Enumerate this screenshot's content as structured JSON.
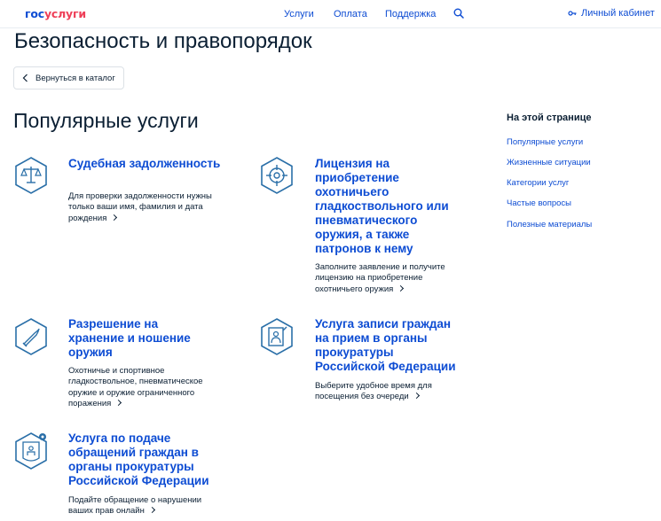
{
  "header": {
    "logo_part1": "гос",
    "logo_part2": "услуги",
    "nav": [
      "Услуги",
      "Оплата",
      "Поддержка"
    ],
    "cabinet_label": "Личный кабинет"
  },
  "page": {
    "title": "Безопасность и правопорядок",
    "back_label": "Вернуться в каталог",
    "section_title": "Популярные услуги"
  },
  "services": [
    {
      "title": "Судебная задолженность",
      "desc": "Для проверки задолженности нужны только ваши имя, фамилия и дата рождения",
      "icon": "scales-icon"
    },
    {
      "title": "Лицензия на приобретение охотничьего гладкоствольного или пневматического оружия, а также патронов к нему",
      "desc": "Заполните заявление и получите лицензию на приобретение охотничьего оружия",
      "icon": "target-icon"
    },
    {
      "title": "Разрешение на хранение и ношение оружия",
      "desc": "Охотничье и спортивное гладкоствольное, пневматическое оружие и оружие ограниченного поражения",
      "icon": "bullet-icon"
    },
    {
      "title": "Услуга записи граждан на прием в органы прокуратуры Российской Федерации",
      "desc": "Выберите удобное время для посещения без очереди",
      "icon": "appointment-icon"
    },
    {
      "title": "Услуга по подаче обращений граждан в органы прокуратуры Российской Федерации",
      "desc": "Подайте обращение о нарушении ваших прав онлайн",
      "icon": "appeal-icon"
    }
  ],
  "toc": {
    "title": "На этой странице",
    "items": [
      "Популярные услуги",
      "Жизненные ситуации",
      "Категории услуг",
      "Частые вопросы",
      "Полезные материалы"
    ]
  },
  "colors": {
    "accent": "#0d4cd3",
    "brand_red": "#ee3f58",
    "icon_blue": "#2a6fa8",
    "text": "#0b1f33"
  }
}
